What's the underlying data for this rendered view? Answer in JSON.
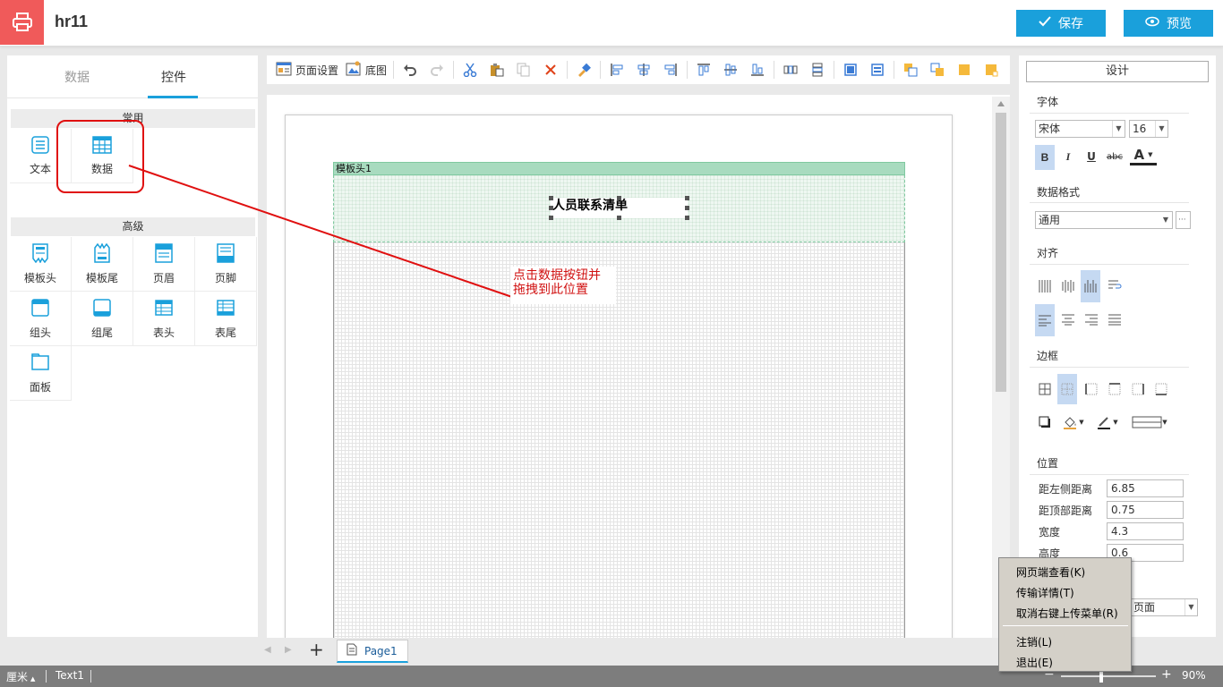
{
  "app": {
    "title": "hr11",
    "save_label": "保存",
    "preview_label": "预览"
  },
  "left_panel": {
    "tabs": [
      "数据",
      "控件"
    ],
    "active_tab": "控件",
    "common_section": "常用",
    "common_items": [
      "文本",
      "数据"
    ],
    "advanced_section": "高级",
    "advanced_items": [
      "模板头",
      "模板尾",
      "页眉",
      "页脚",
      "组头",
      "组尾",
      "表头",
      "表尾",
      "面板"
    ]
  },
  "annotation": {
    "text": "点击数据按钮并拖拽到此位置",
    "line1": "点击数据按钮并",
    "line2": "拖拽到此位置",
    "color": "#e01010"
  },
  "toolbar": {
    "page_setup_label": "页面设置",
    "background_label": "底图",
    "icons": [
      "undo-icon",
      "redo-icon",
      "cut-icon",
      "paste-icon",
      "copy-icon",
      "delete-icon",
      "format-brush-icon",
      "align-left-icon",
      "align-center-icon",
      "align-right-icon",
      "align-top-icon",
      "align-middle-icon",
      "align-bottom-icon",
      "distribute-horizontal-icon",
      "distribute-vertical-icon",
      "same-width-icon",
      "same-height-icon",
      "bring-front-icon",
      "send-back-icon",
      "bring-forward-icon",
      "send-backward-icon"
    ]
  },
  "canvas": {
    "band_label": "模板头1",
    "title_text": "人员联系清单"
  },
  "right_panel": {
    "design_label": "设计",
    "font_section": "字体",
    "font_name": "宋体",
    "font_size": "16",
    "bold": "B",
    "italic": "I",
    "underline": "U",
    "strike": "abc",
    "font_color": "A",
    "data_format_section": "数据格式",
    "data_format_value": "通用",
    "more_btn": "···",
    "align_section": "对齐",
    "border_section": "边框",
    "position_section": "位置",
    "position_fields": [
      {
        "label": "距左侧距离",
        "value": "6.85"
      },
      {
        "label": "距顶部距离",
        "value": "0.75"
      },
      {
        "label": "宽度",
        "value": "4.3"
      },
      {
        "label": "高度",
        "value": "0.6"
      }
    ],
    "page_select_value": "页面"
  },
  "page_tabs": {
    "add": "+",
    "current_page": "Page1"
  },
  "statusbar": {
    "unit": "厘米",
    "selected": "Text1",
    "zoom_minus": "−",
    "zoom_plus": "+",
    "zoom": "90%"
  },
  "context_menu": {
    "items": [
      "网页端查看(K)",
      "传输详情(T)",
      "取消右键上传菜单(R)",
      "注销(L)",
      "退出(E)"
    ]
  },
  "colors": {
    "accent": "#1aa0db",
    "logo": "#f05a5a",
    "band_green": "#a8dbbf"
  }
}
